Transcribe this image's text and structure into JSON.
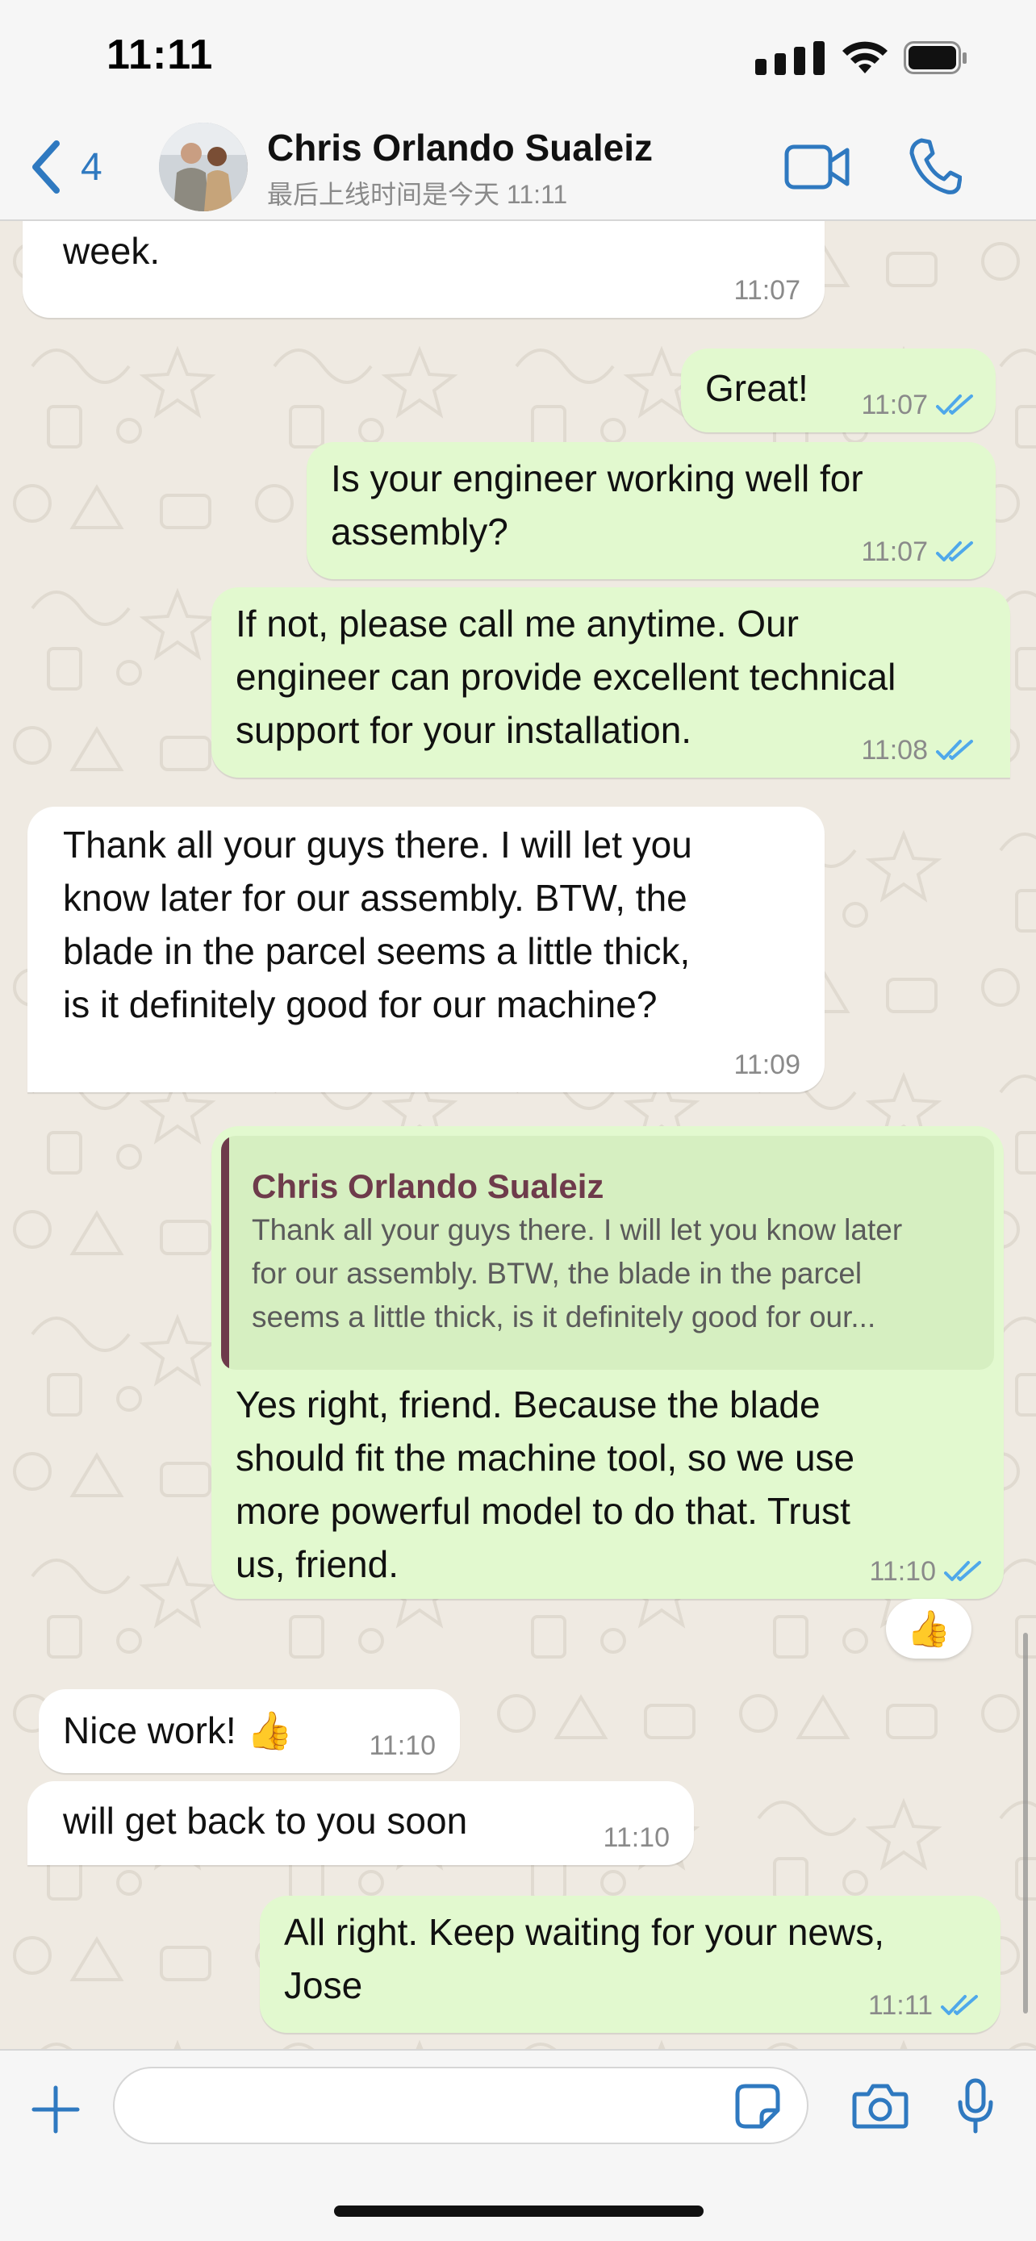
{
  "status_bar": {
    "time": "11:11"
  },
  "header": {
    "back_count": "4",
    "contact_name": "Chris Orlando Sualeiz",
    "contact_status": "最后上线时间是今天 11:11",
    "accent_color": "#2f79c0"
  },
  "messages": [
    {
      "direction": "incoming",
      "text": "machine. I think it should be done this\nweek.",
      "time": "11:07"
    },
    {
      "direction": "outgoing",
      "text": "Great!",
      "time": "11:07",
      "status": "read"
    },
    {
      "direction": "outgoing",
      "text": "Is your engineer working well for\nassembly?",
      "time": "11:07",
      "status": "read"
    },
    {
      "direction": "outgoing",
      "text": "If not, please call me anytime. Our\nengineer can provide excellent technical\nsupport for your installation.",
      "time": "11:08",
      "status": "read"
    },
    {
      "direction": "incoming",
      "text": "Thank all your guys there. I will let you\nknow later for our assembly. BTW, the\nblade in the parcel seems a little thick,\nis it definitely good for our machine?",
      "time": "11:09"
    },
    {
      "direction": "outgoing",
      "quote": {
        "author": "Chris Orlando Sualeiz",
        "text": "Thank all your guys there. I will let you know later\nfor our assembly. BTW, the blade in the parcel\nseems a little thick, is it definitely good for our..."
      },
      "text": "Yes right, friend. Because the blade\nshould fit the machine tool, so we use\nmore powerful model to do that. Trust\nus, friend.",
      "time": "11:10",
      "status": "read",
      "reaction": "👍"
    },
    {
      "direction": "incoming",
      "text": "Nice work! 👍",
      "time": "11:10"
    },
    {
      "direction": "incoming",
      "text": "will get back to you soon",
      "time": "11:10"
    },
    {
      "direction": "outgoing",
      "text": "All right. Keep waiting for your news,\nJose",
      "time": "11:11",
      "status": "read"
    }
  ],
  "input": {
    "placeholder": "",
    "value": ""
  },
  "colors": {
    "outgoing_bubble": "#e2f9cf",
    "incoming_bubble": "#ffffff",
    "read_ticks": "#4fa8ea",
    "quote_author": "#6e3b4b"
  }
}
